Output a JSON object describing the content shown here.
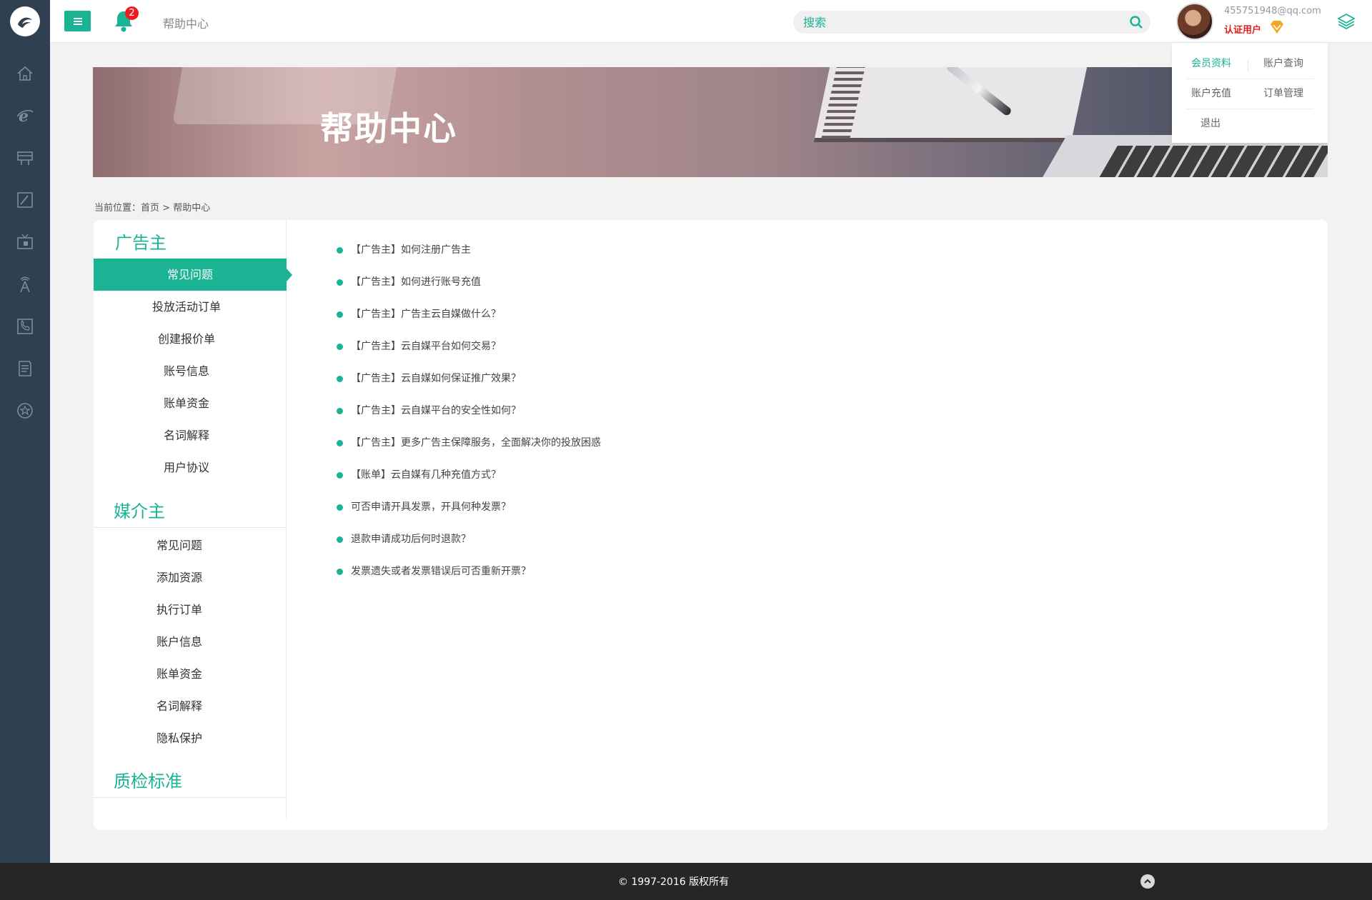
{
  "header": {
    "page_title": "帮助中心",
    "notification_count": "2",
    "search_placeholder": "搜索",
    "user_email": "455751948@qq.com",
    "user_role": "认证用户"
  },
  "sidebar": {
    "icons": [
      "home-icon",
      "ie-browser-icon",
      "billboard-icon",
      "pen-icon",
      "tv-icon",
      "antenna-icon",
      "phone-icon",
      "document-icon",
      "star-icon"
    ]
  },
  "user_menu": {
    "items": [
      {
        "label": "会员资料",
        "active": true
      },
      {
        "label": "账户查询",
        "active": false
      },
      {
        "label": "账户充值",
        "active": false
      },
      {
        "label": "订单管理",
        "active": false
      },
      {
        "label": "退出",
        "active": false
      }
    ]
  },
  "banner": {
    "title": "帮助中心"
  },
  "breadcrumb": {
    "prefix": "当前位置：",
    "home": "首页",
    "separator": " > ",
    "current": "帮助中心"
  },
  "sections": {
    "advertiser": {
      "title": "广告主",
      "items": [
        "常见问题",
        "投放活动订单",
        "创建报价单",
        "账号信息",
        "账单资金",
        "名词解释",
        "用户协议"
      ],
      "active_index": 0
    },
    "media": {
      "title": "媒介主",
      "items": [
        "常见问题",
        "添加资源",
        "执行订单",
        "账户信息",
        "账单资金",
        "名词解释",
        "隐私保护"
      ]
    },
    "quality": {
      "title": "质检标准"
    }
  },
  "faq": [
    "【广告主】如何注册广告主",
    "【广告主】如何进行账号充值",
    "【广告主】广告主云自媒做什么？",
    "【广告主】云自媒平台如何交易？",
    "【广告主】云自媒如何保证推广效果？",
    "【广告主】云自媒平台的安全性如何？",
    "【广告主】更多广告主保障服务，全面解决你的投放困惑",
    "【账单】云自媒有几种充值方式？",
    "可否申请开具发票，开具何种发票？",
    "退款申请成功后何时退款？",
    "发票遗失或者发票错误后可否重新开票？"
  ],
  "footer": {
    "copyright": "© 1997-2016 版权所有"
  },
  "colors": {
    "accent": "#1ab394",
    "sidebar": "#2f4050",
    "footer": "#262626",
    "badge": "#ed1c24",
    "role": "#e02020"
  }
}
